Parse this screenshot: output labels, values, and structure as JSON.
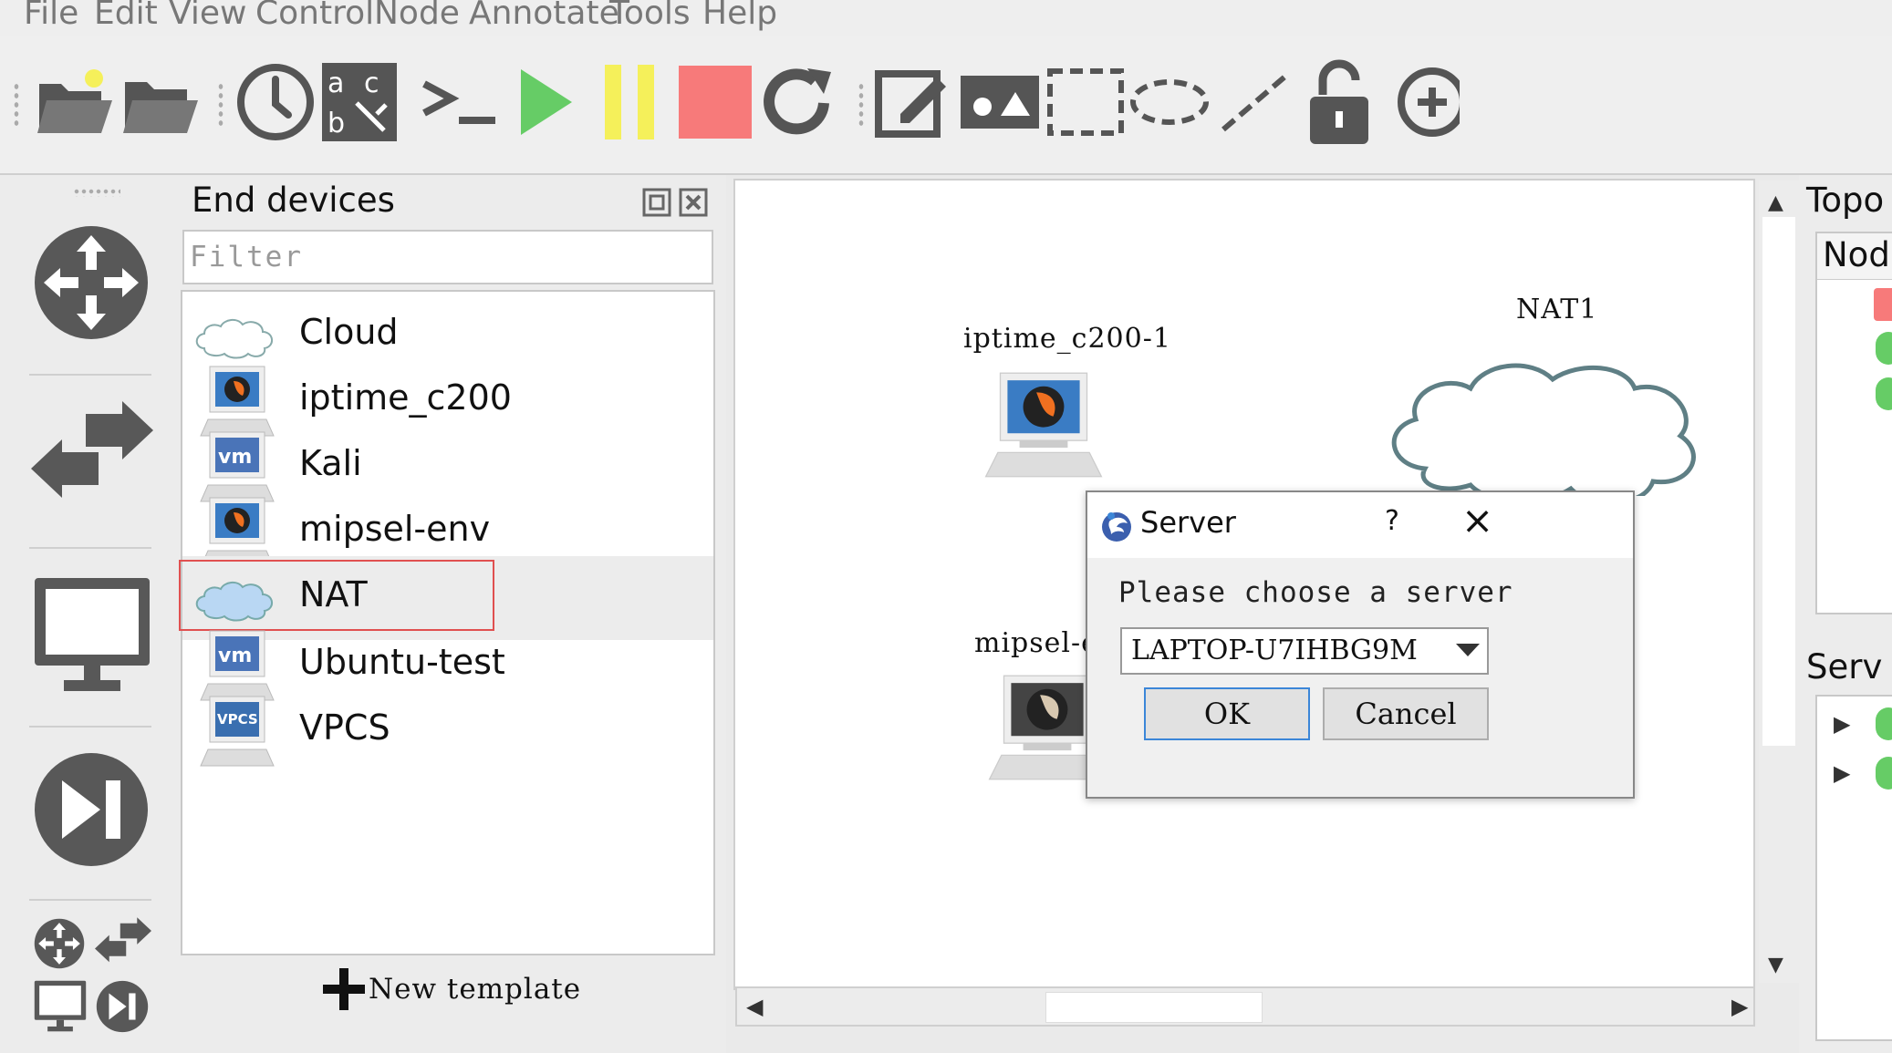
{
  "menu": [
    "File",
    "Edit",
    "View",
    "Control",
    "Node",
    "Annotate",
    "Tools",
    "Help"
  ],
  "devices_panel": {
    "title": "End devices",
    "filter_placeholder": "Filter",
    "items": [
      {
        "label": "Cloud",
        "icon": "cloud-icon"
      },
      {
        "label": "iptime_c200",
        "icon": "qemu-computer-icon"
      },
      {
        "label": "Kali",
        "icon": "vmware-computer-icon"
      },
      {
        "label": "mipsel-env",
        "icon": "qemu-computer-icon"
      },
      {
        "label": "NAT",
        "icon": "nat-cloud-icon",
        "selected": true
      },
      {
        "label": "Ubuntu-test",
        "icon": "vmware-computer-icon"
      },
      {
        "label": "VPCS",
        "icon": "vpcs-computer-icon"
      }
    ],
    "new_template": "New template"
  },
  "canvas": {
    "nodes": [
      {
        "label": "iptime_c200-1",
        "icon": "qemu-computer-icon"
      },
      {
        "label": "NAT1",
        "icon": "cloud-icon"
      },
      {
        "label": "mipsel-e",
        "icon": "qemu-computer-icon"
      }
    ]
  },
  "right_dock": {
    "topology_title": "Topo",
    "nodes_header": "Nod",
    "servers_title": "Serv"
  },
  "dialog": {
    "title": "Server",
    "help": "?",
    "close": "×",
    "prompt": "Please choose a server",
    "selected_server": "LAPTOP-U7IHBG9M",
    "ok": "OK",
    "cancel": "Cancel"
  },
  "colors": {
    "start": "#66cc66",
    "suspend": "#f5f05a",
    "stop": "#f77a7a",
    "icon_gray": "#555555",
    "cloud_stroke": "#5f7f85",
    "nat_fill": "#b9d7f3",
    "accent": "#3b86d8"
  }
}
